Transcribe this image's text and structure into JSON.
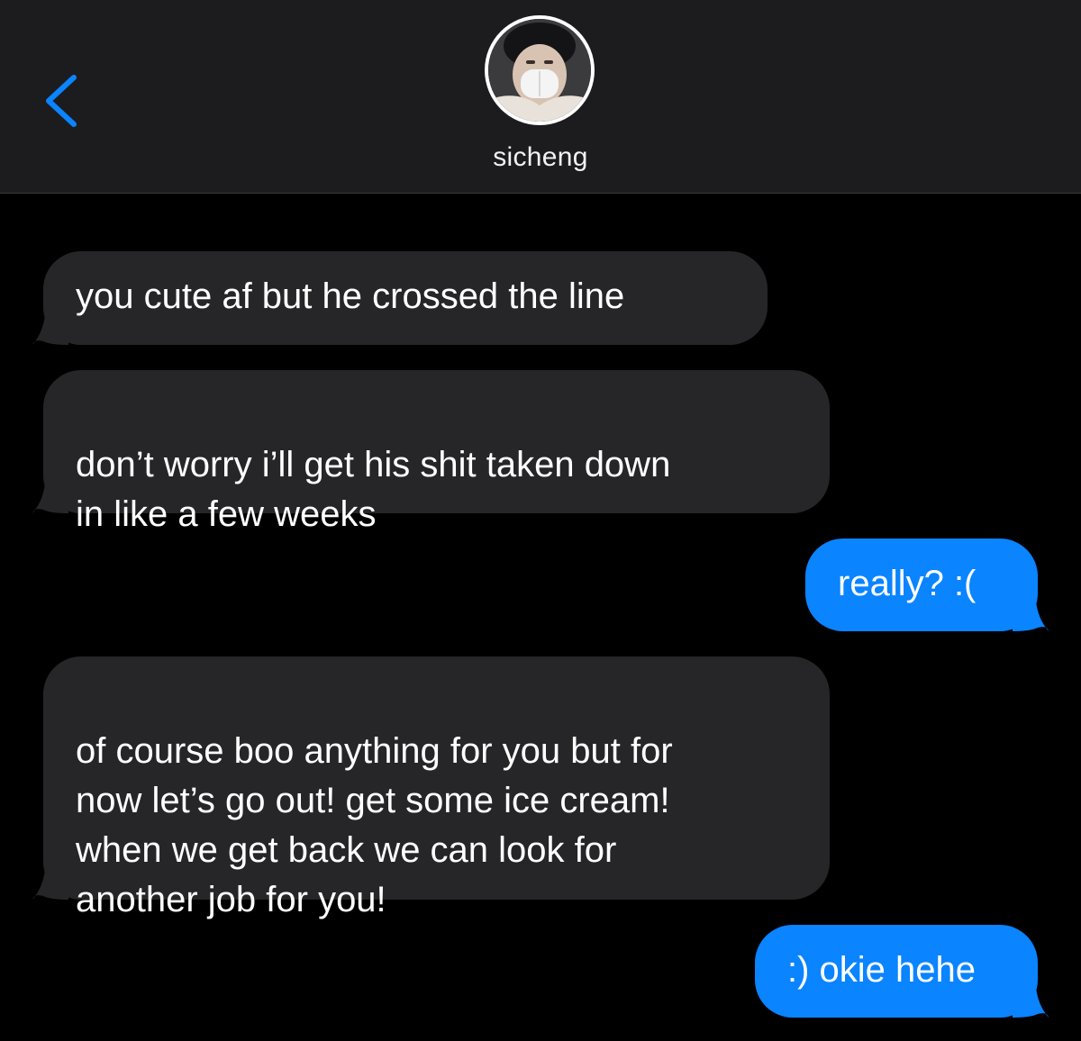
{
  "header": {
    "contact_name": "sicheng",
    "back_label": "<"
  },
  "colors": {
    "accent": "#0a84ff",
    "received_bubble": "#262628",
    "header_bg": "#1c1c1e",
    "background": "#000000"
  },
  "messages": [
    {
      "direction": "received",
      "text": "you cute af but he crossed the line"
    },
    {
      "direction": "received",
      "text": "don’t worry i’ll get his shit taken down\nin like a few weeks"
    },
    {
      "direction": "sent",
      "text": "really? :("
    },
    {
      "direction": "received",
      "text": "of course boo anything for you but for\nnow let’s go out! get some ice cream!\nwhen we get back we can look for\nanother job for you!"
    },
    {
      "direction": "sent",
      "text": ":) okie hehe"
    }
  ]
}
